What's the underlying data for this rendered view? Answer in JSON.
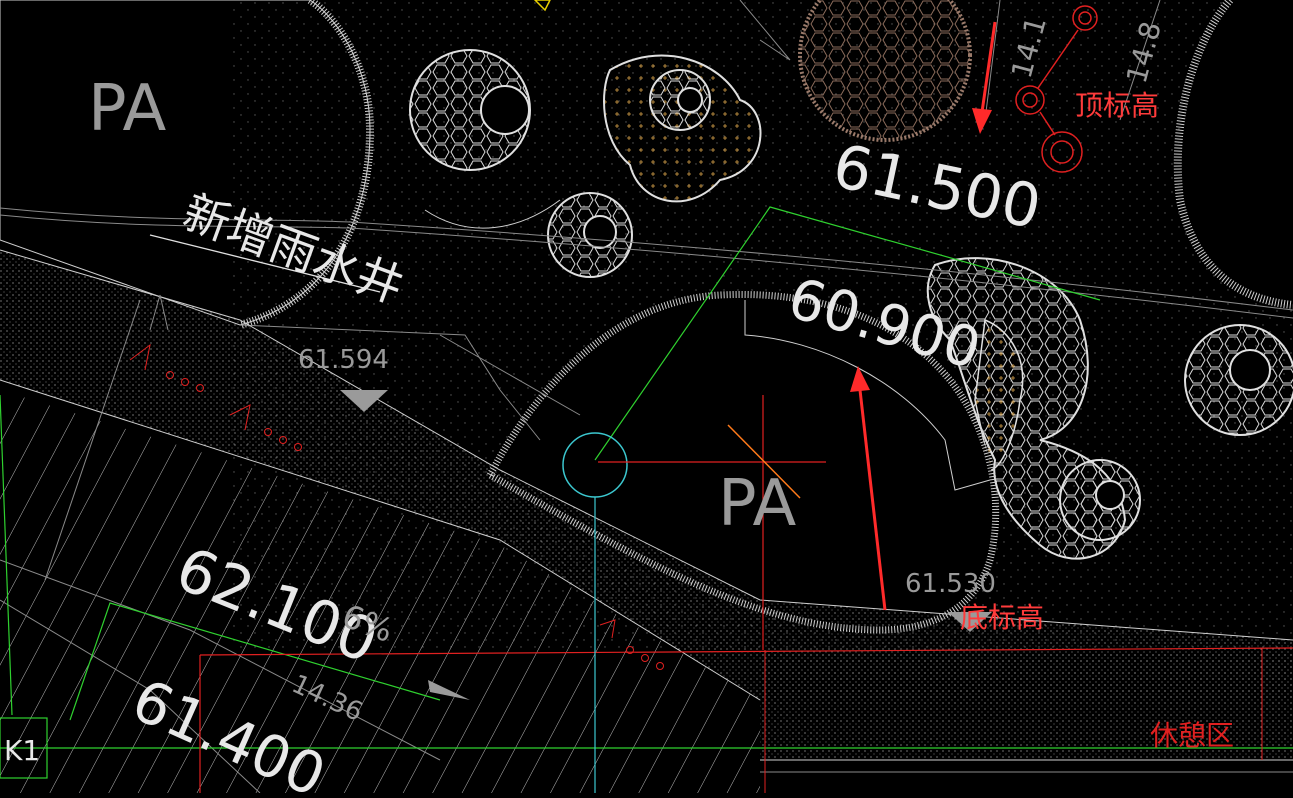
{
  "drawing": {
    "elevation_labels": {
      "top_right": "61.500",
      "center": "60.900",
      "left_large": "62.100",
      "left_lower": "61.400",
      "small_left": "61.594",
      "small_right": "61.530",
      "slope_left": "6%",
      "small_left_lower": "14.36",
      "top_right_small_a": "14.1",
      "top_right_small_b": "14.8"
    },
    "area_labels": {
      "pa_left": "PA",
      "pa_center": "PA"
    },
    "texts": {
      "new_well": "新增雨水井",
      "label_k1": "K1",
      "bottom_right_red": "休憩区"
    },
    "annotations": {
      "top_elevation": "顶标高",
      "bottom_elevation": "底标高"
    },
    "colors": {
      "background": "#000000",
      "annotation_red": "#ff2a2a",
      "cad_red": "#e02020",
      "cad_green": "#2fd12f",
      "cad_cyan": "#3cc8d0",
      "cad_orange": "#ff7a1a"
    }
  }
}
